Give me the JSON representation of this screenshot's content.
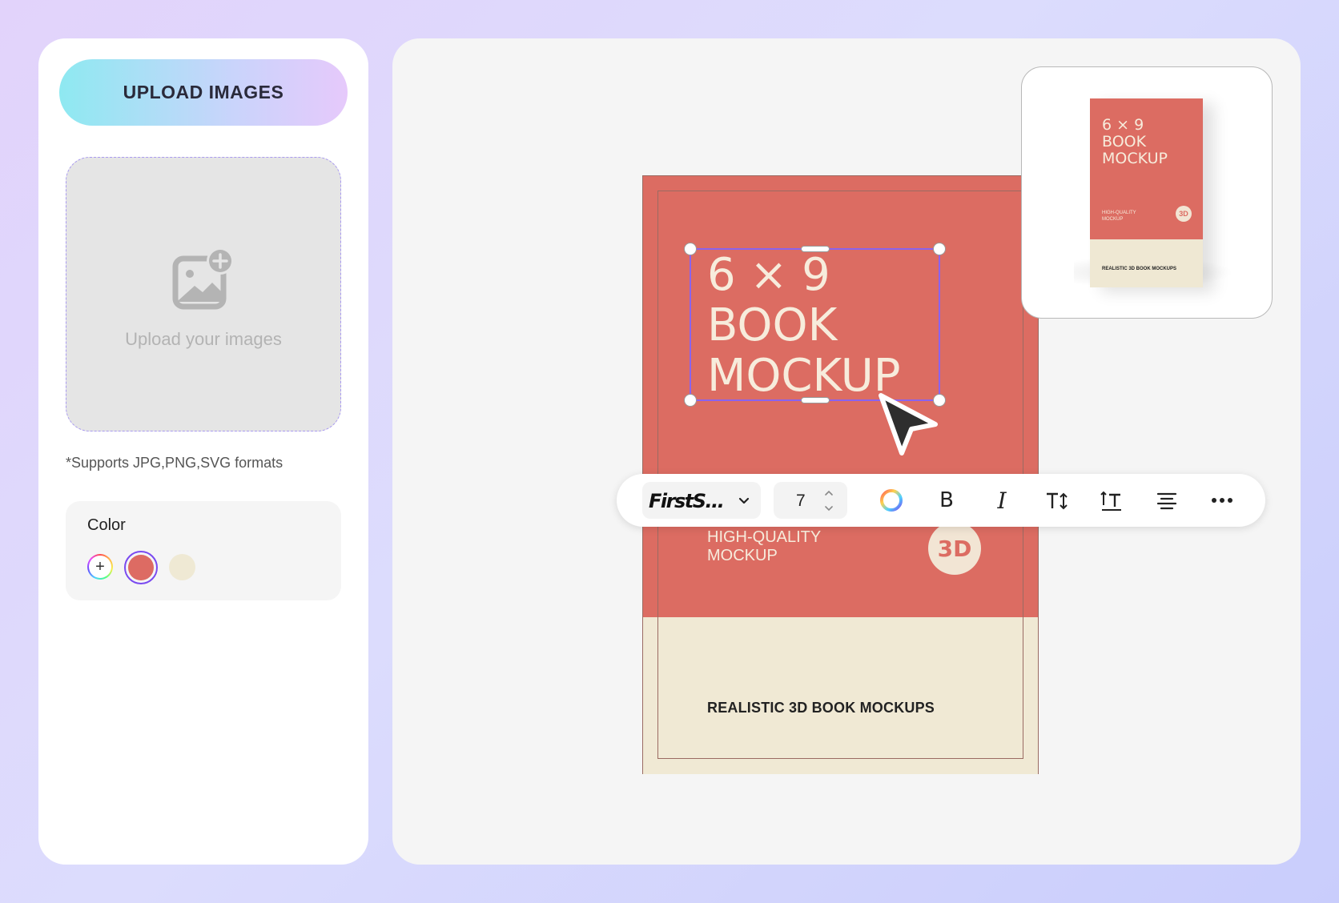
{
  "sidebar": {
    "upload_button": "UPLOAD IMAGES",
    "dropzone_text": "Upload your images",
    "formats_note": "*Supports JPG,PNG,SVG formats",
    "color_title": "Color",
    "swatches": [
      {
        "name": "add-color",
        "color": "rainbow"
      },
      {
        "name": "coral",
        "color": "#dd6b63",
        "selected": true
      },
      {
        "name": "cream",
        "color": "#efe9d4"
      }
    ]
  },
  "book": {
    "title_lines": [
      "6 × 9",
      "BOOK",
      "MOCKUP"
    ],
    "subtitle_lines": [
      "HIGH-QUALITY",
      "MOCKUP"
    ],
    "badge": "3D",
    "tagline": "REALISTIC 3D BOOK MOCKUPS",
    "colors": {
      "cover": "#dc6c62",
      "band": "#f0e9d4",
      "text": "#f7ecdc"
    }
  },
  "toolbar": {
    "font_name": "FirstS...",
    "font_size": "7",
    "bold_label": "B",
    "italic_label": "I",
    "icons": [
      "chevron-down-icon",
      "stepper-up-icon",
      "stepper-down-icon",
      "color-wheel-icon",
      "text-size-icon",
      "line-height-icon",
      "align-center-icon",
      "more-icon"
    ]
  },
  "preview": {
    "title_lines": [
      "6 × 9",
      "BOOK",
      "MOCKUP"
    ],
    "subtitle_lines": [
      "HIGH-QUALITY",
      "MOCKUP"
    ],
    "badge": "3D",
    "tagline": "REALISTIC 3D BOOK MOCKUPS"
  },
  "accent_color": "#8a63ee"
}
